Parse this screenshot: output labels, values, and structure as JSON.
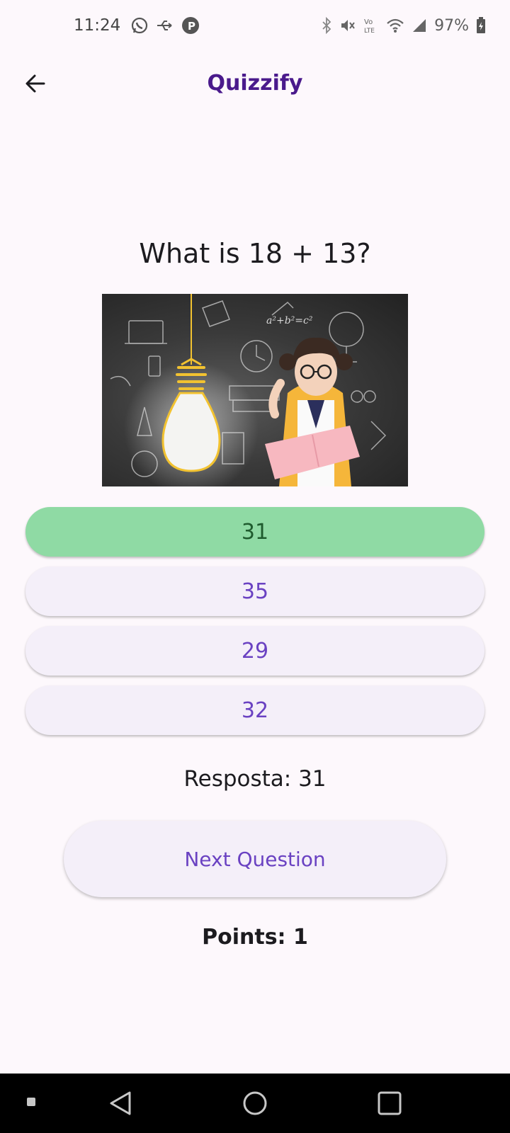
{
  "status_bar": {
    "time": "11:24",
    "battery": "97%",
    "left_icons": [
      "whatsapp-icon",
      "usb-icon",
      "parking-icon"
    ],
    "right_icons": [
      "bluetooth-icon",
      "mute-icon",
      "volte-icon",
      "wifi-icon",
      "signal-icon",
      "battery-icon"
    ]
  },
  "app_bar": {
    "title": "Quizzify",
    "back_icon": "arrow-back-icon",
    "title_color": "#4a1a8c"
  },
  "question": {
    "text": "What is 18 + 13?",
    "image_alt": "lightbulb-and-girl-illustration"
  },
  "answers": [
    {
      "label": "31",
      "state": "correct"
    },
    {
      "label": "35",
      "state": "default"
    },
    {
      "label": "29",
      "state": "default"
    },
    {
      "label": "32",
      "state": "default"
    }
  ],
  "result": {
    "answer_text": "Resposta: 31"
  },
  "next_button": {
    "label": "Next Question"
  },
  "score": {
    "text": "Points: 1"
  },
  "nav_bar": {
    "icons": [
      "recents-dot-icon",
      "back-triangle-icon",
      "home-circle-icon",
      "overview-square-icon"
    ]
  },
  "colors": {
    "correct": "#8fdaa4",
    "button_bg": "#f4eff9",
    "accent_text": "#6a42c2",
    "background": "#fdf8fc"
  }
}
